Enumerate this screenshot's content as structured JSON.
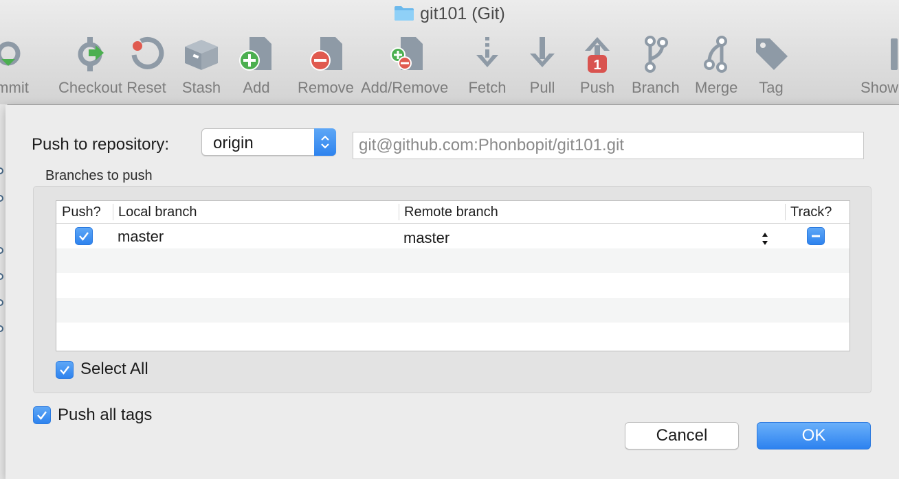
{
  "window": {
    "title": "git101 (Git)"
  },
  "toolbar": {
    "items": [
      {
        "label": "mmit",
        "icon": "commit-icon"
      },
      {
        "label": "Checkout",
        "icon": "checkout-icon"
      },
      {
        "label": "Reset",
        "icon": "reset-icon"
      },
      {
        "label": "Stash",
        "icon": "stash-icon"
      },
      {
        "label": "Add",
        "icon": "add-icon"
      },
      {
        "label": "Remove",
        "icon": "remove-icon"
      },
      {
        "label": "Add/Remove",
        "icon": "add-remove-icon"
      },
      {
        "label": "Fetch",
        "icon": "fetch-icon"
      },
      {
        "label": "Pull",
        "icon": "pull-icon"
      },
      {
        "label": "Push",
        "icon": "push-icon",
        "badge": "1"
      },
      {
        "label": "Branch",
        "icon": "branch-icon"
      },
      {
        "label": "Merge",
        "icon": "merge-icon"
      },
      {
        "label": "Tag",
        "icon": "tag-icon"
      },
      {
        "label": "Show",
        "icon": "show-icon"
      }
    ]
  },
  "dialog": {
    "push_to_label": "Push to repository:",
    "repository": "origin",
    "repository_url": "git@github.com:Phonbopit/git101.git",
    "branches_label": "Branches to push",
    "columns": {
      "push": "Push?",
      "local": "Local branch",
      "remote": "Remote branch",
      "track": "Track?"
    },
    "rows": [
      {
        "push": true,
        "local": "master",
        "remote": "master",
        "track": "mixed"
      }
    ],
    "select_all_label": "Select All",
    "select_all_checked": true,
    "push_all_tags_label": "Push all tags",
    "push_all_tags_checked": true,
    "cancel_label": "Cancel",
    "ok_label": "OK"
  },
  "colors": {
    "accent": "#2e83ee",
    "toolbar_icon": "#8e9aa6",
    "add_green": "#4caf50",
    "remove_red": "#e05a4f",
    "push_badge": "#d9534f"
  }
}
